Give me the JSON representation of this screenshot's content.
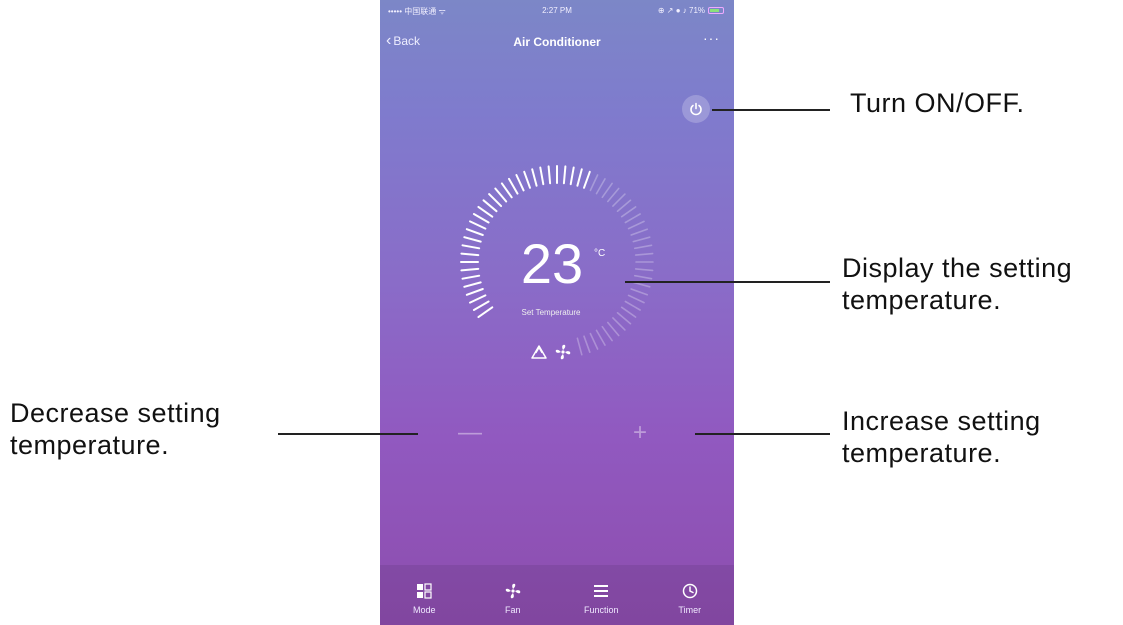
{
  "status_bar": {
    "carrier": "••••• 中国联通 ᯤ",
    "time": "2:27 PM",
    "right_icons": "⊕ ↗ ● ♪ 71%",
    "battery_percent": 71
  },
  "nav": {
    "back_label": "Back",
    "title": "Air Conditioner",
    "more": "···"
  },
  "thermostat": {
    "temperature": "23",
    "unit": "°C",
    "label": "Set Temperature",
    "arc_level": 0.5
  },
  "stepper": {
    "minus": "—",
    "plus": "+"
  },
  "tabs": [
    {
      "label": "Mode",
      "icon": "mode-icon"
    },
    {
      "label": "Fan",
      "icon": "fan-icon"
    },
    {
      "label": "Function",
      "icon": "menu-icon"
    },
    {
      "label": "Timer",
      "icon": "clock-icon"
    }
  ],
  "annotations": {
    "power": "Turn ON/OFF.",
    "display_line1": "Display the setting",
    "display_line2": "temperature.",
    "decrease_line1": "Decrease setting",
    "decrease_line2": "temperature.",
    "increase_line1": "Increase setting",
    "increase_line2": "temperature."
  },
  "colors": {
    "gradient_top": "#7c87c7",
    "gradient_bottom": "#8d4dad"
  }
}
